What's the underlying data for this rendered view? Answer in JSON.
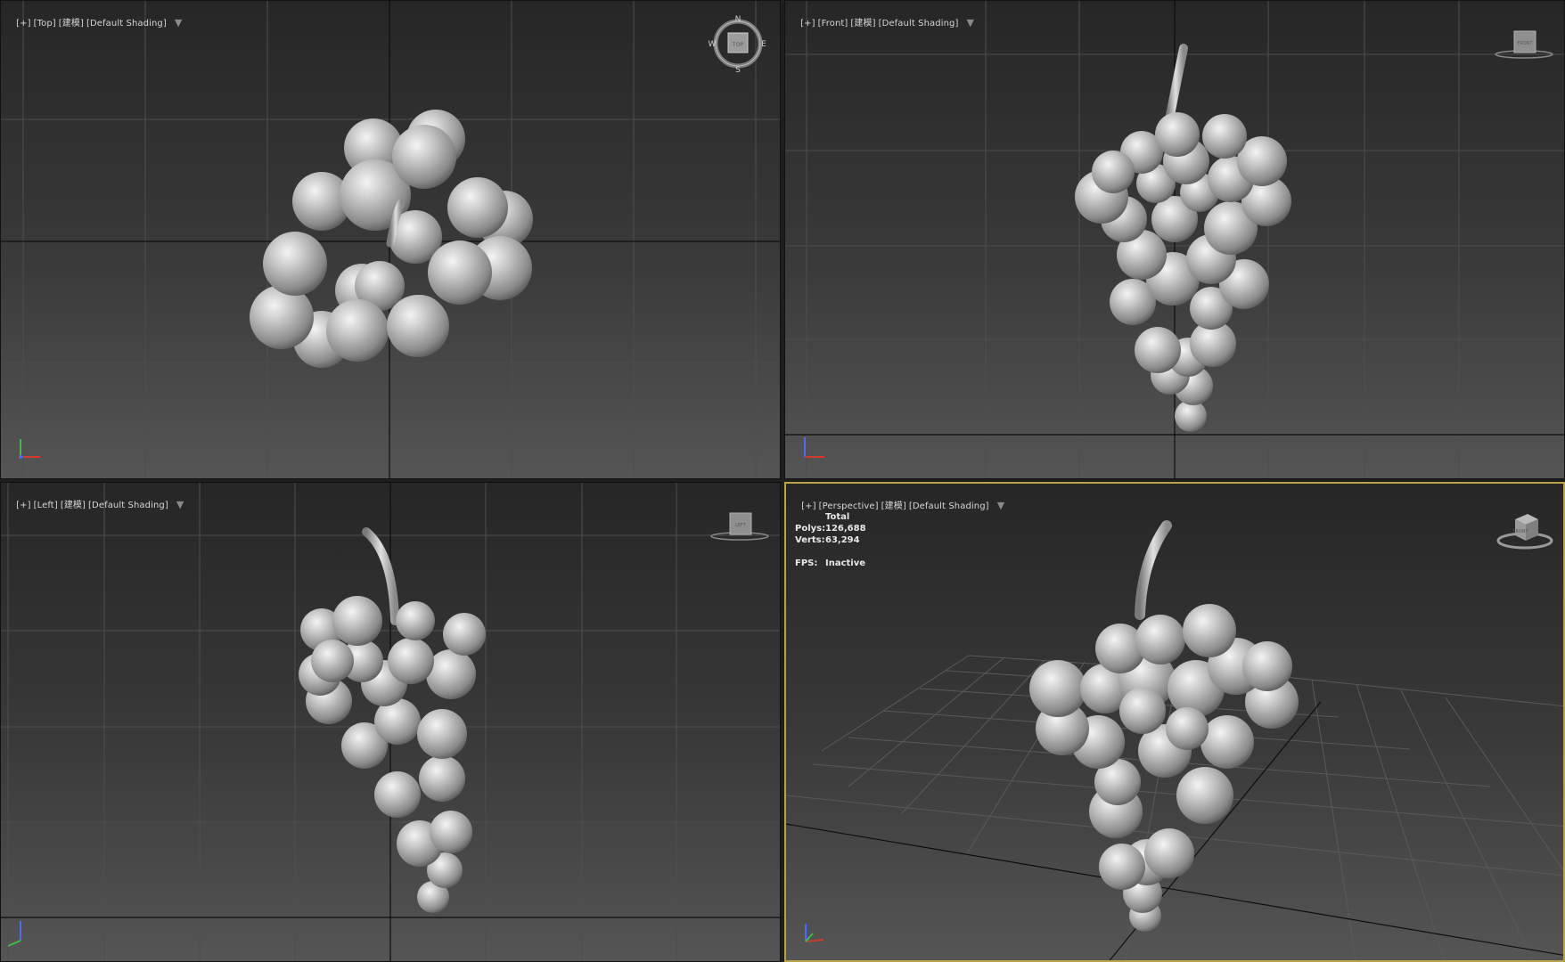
{
  "viewports": {
    "top": {
      "plus": "[+]",
      "view": "[Top]",
      "mode": "[建模]",
      "shading": "[Default Shading]"
    },
    "front": {
      "plus": "[+]",
      "view": "[Front]",
      "mode": "[建模]",
      "shading": "[Default Shading]"
    },
    "left": {
      "plus": "[+]",
      "view": "[Left]",
      "mode": "[建模]",
      "shading": "[Default Shading]"
    },
    "perspective": {
      "plus": "[+]",
      "view": "[Perspective]",
      "mode": "[建模]",
      "shading": "[Default Shading]",
      "active_border_color": "#b8a34a"
    }
  },
  "filter_icon": "funnel-icon",
  "stats": {
    "total_label": "Total",
    "polys_label": "Polys:",
    "polys_value": "126,688",
    "verts_label": "Verts:",
    "verts_value": "63,294",
    "fps_label": "FPS:",
    "fps_value": "Inactive"
  },
  "compass": {
    "n": "N",
    "s": "S",
    "e": "E",
    "w": "W",
    "cube_face": "TOP"
  },
  "viewcube_faces": {
    "front": "FRONT",
    "left": "LEFT",
    "perspective": "FRONT"
  },
  "axis_colors": {
    "x": "#d23b2b",
    "y": "#3fbf3f",
    "z": "#4b6bff"
  },
  "grape_color": "#bdbdbd"
}
